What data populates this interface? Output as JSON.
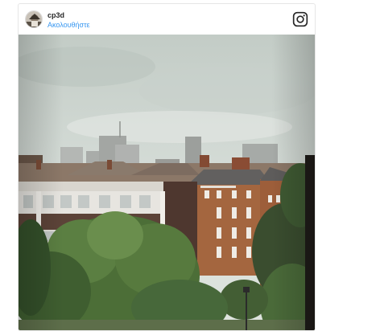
{
  "post": {
    "username": "cp3d",
    "follow_label": "Ακολουθήστε"
  },
  "icons": {
    "avatar": "profile-avatar",
    "logo": "instagram-icon"
  },
  "colors": {
    "link": "#3897f0",
    "username": "#262626",
    "border": "#e6e6e6"
  }
}
